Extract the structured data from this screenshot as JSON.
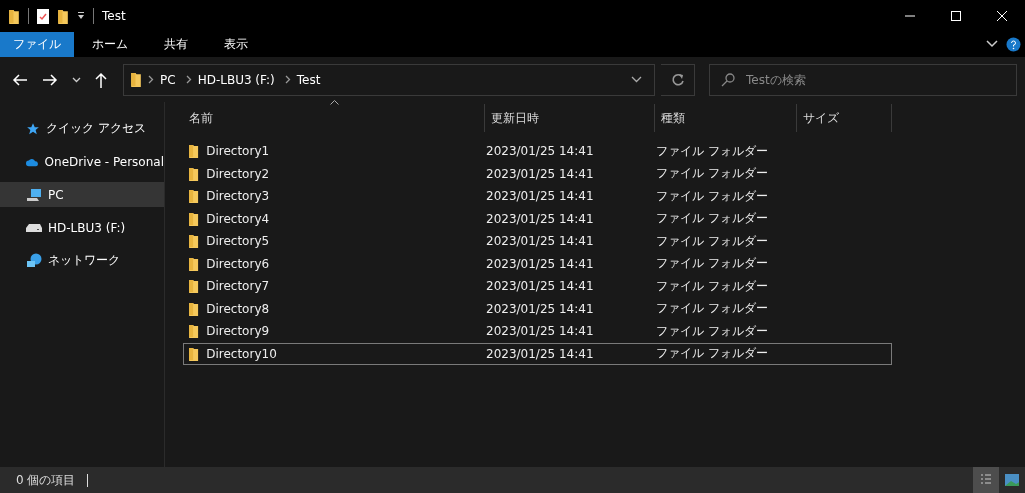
{
  "window": {
    "title": "Test"
  },
  "ribbon_tabs": [
    {
      "label": "ファイル",
      "selected": true
    },
    {
      "label": "ホーム",
      "selected": false
    },
    {
      "label": "共有",
      "selected": false
    },
    {
      "label": "表示",
      "selected": false
    }
  ],
  "breadcrumb": [
    "PC",
    "HD-LBU3 (F:)",
    "Test"
  ],
  "search": {
    "placeholder": "Testの検索"
  },
  "sidebar": {
    "items": [
      {
        "label": "クイック アクセス",
        "kind": "star",
        "selected": false
      },
      {
        "label": "OneDrive - Personal",
        "kind": "cloud",
        "selected": false
      },
      {
        "label": "PC",
        "kind": "pc",
        "selected": true
      },
      {
        "label": "HD-LBU3 (F:)",
        "kind": "drive",
        "selected": false
      },
      {
        "label": "ネットワーク",
        "kind": "network",
        "selected": false
      }
    ]
  },
  "table": {
    "columns": [
      {
        "label": "名前",
        "sorted": true
      },
      {
        "label": "更新日時",
        "sorted": false
      },
      {
        "label": "種類",
        "sorted": false
      },
      {
        "label": "サイズ",
        "sorted": false
      }
    ],
    "rows": [
      {
        "name": "Directory1",
        "modified": "2023/01/25 14:41",
        "type": "ファイル フォルダー",
        "focused": false
      },
      {
        "name": "Directory2",
        "modified": "2023/01/25 14:41",
        "type": "ファイル フォルダー",
        "focused": false
      },
      {
        "name": "Directory3",
        "modified": "2023/01/25 14:41",
        "type": "ファイル フォルダー",
        "focused": false
      },
      {
        "name": "Directory4",
        "modified": "2023/01/25 14:41",
        "type": "ファイル フォルダー",
        "focused": false
      },
      {
        "name": "Directory5",
        "modified": "2023/01/25 14:41",
        "type": "ファイル フォルダー",
        "focused": false
      },
      {
        "name": "Directory6",
        "modified": "2023/01/25 14:41",
        "type": "ファイル フォルダー",
        "focused": false
      },
      {
        "name": "Directory7",
        "modified": "2023/01/25 14:41",
        "type": "ファイル フォルダー",
        "focused": false
      },
      {
        "name": "Directory8",
        "modified": "2023/01/25 14:41",
        "type": "ファイル フォルダー",
        "focused": false
      },
      {
        "name": "Directory9",
        "modified": "2023/01/25 14:41",
        "type": "ファイル フォルダー",
        "focused": false
      },
      {
        "name": "Directory10",
        "modified": "2023/01/25 14:41",
        "type": "ファイル フォルダー",
        "focused": true
      }
    ]
  },
  "status_bar": {
    "text": "0 個の項目",
    "views": [
      {
        "kind": "details",
        "selected": true
      },
      {
        "kind": "tiles",
        "selected": false
      }
    ]
  }
}
